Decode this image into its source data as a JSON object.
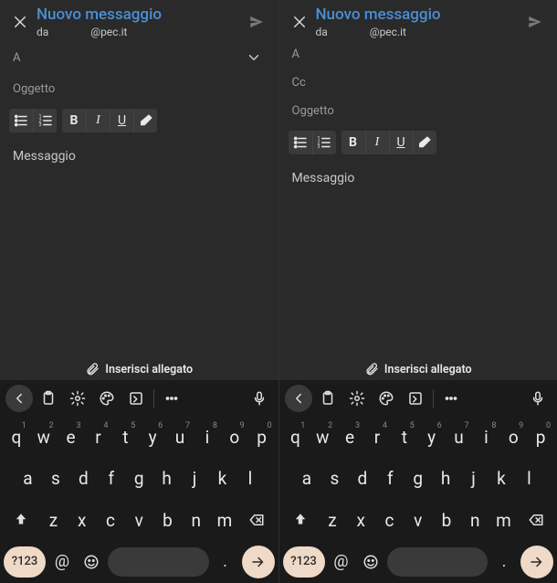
{
  "panes": [
    {
      "title": "Nuovo messaggio",
      "from_label": "da",
      "from_addr": "@pec.it",
      "to_label": "A",
      "show_expand": true,
      "show_cc": false,
      "cc_label": "Cc",
      "subject": "Oggetto",
      "message": "Messaggio",
      "attach_label": "Inserisci allegato"
    },
    {
      "title": "Nuovo messaggio",
      "from_label": "da",
      "from_addr": "@pec.it",
      "to_label": "A",
      "show_expand": false,
      "show_cc": true,
      "cc_label": "Cc",
      "subject": "Oggetto",
      "message": "Messaggio",
      "attach_label": "Inserisci allegato"
    }
  ],
  "fmt": {
    "bold": "B",
    "italic": "I",
    "underline": "U"
  },
  "keyboard": {
    "sym_label": "?123",
    "row1": [
      {
        "k": "q",
        "s": "1"
      },
      {
        "k": "w",
        "s": "2"
      },
      {
        "k": "e",
        "s": "3"
      },
      {
        "k": "r",
        "s": "4"
      },
      {
        "k": "t",
        "s": "5"
      },
      {
        "k": "y",
        "s": "6"
      },
      {
        "k": "u",
        "s": "7"
      },
      {
        "k": "i",
        "s": "8"
      },
      {
        "k": "o",
        "s": "9"
      },
      {
        "k": "p",
        "s": "0"
      }
    ],
    "row2": [
      "a",
      "s",
      "d",
      "f",
      "g",
      "h",
      "j",
      "k",
      "l"
    ],
    "row3": [
      "z",
      "x",
      "c",
      "v",
      "b",
      "n",
      "m"
    ],
    "at": "@",
    "period": "."
  }
}
